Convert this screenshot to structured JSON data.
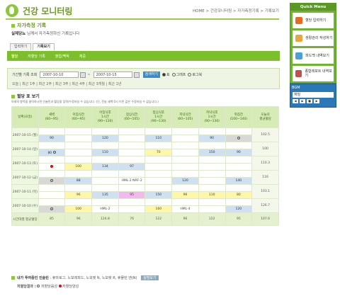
{
  "header": {
    "title": "건강 모니터링",
    "breadcrumb": "HOME > 건강모니터링 > 자가측정기록 > 기록보기"
  },
  "section": {
    "title": "자가측정 기록"
  },
  "greeting": {
    "name": "실제당뇨",
    "text": "님께서 자가측정하신 기록입니다"
  },
  "tabs": [
    {
      "label": "입력하기"
    },
    {
      "label": "기록보기"
    }
  ],
  "subnav": [
    {
      "label": "혈당"
    },
    {
      "label": "자혈당 기록"
    },
    {
      "label": "혈압/맥박"
    },
    {
      "label": "체중"
    }
  ],
  "search": {
    "label": "기간별 기록 조회",
    "start": "2007-10-10",
    "end": "2007-10-15",
    "button": "검색하기",
    "view1": "표",
    "view2": "그래프",
    "view3": "로그북",
    "quick": "오늘 | 최근 1주 | 최근 2주 | 최근 3주 | 최근 4주 | 최근 3개월 | 최근 1년"
  },
  "table_title": "혈당 표 보기",
  "note": "아래의 항목을 클릭하시면 인슐린과 혈당을 입력/수정하실 수 있습니다. (단, 전날 새벽 0시 이전 값은 수정하실 수 없습니다.)",
  "columns": [
    "날짜(요일)",
    "새벽\n(60~95)",
    "아침식전\n(60~95)",
    "아침식후\n1시간\n(90~130)",
    "점심식전\n(60~105)",
    "점심식후\n1시간\n(90~130)",
    "저녁식전\n(60~105)",
    "저녁식후\n1시간\n(90~130)",
    "취침전\n(100~140)",
    "오늘의\n평균혈당"
  ],
  "rows": [
    {
      "date": "2007-10-15 (월)",
      "avg": "102.5",
      "cells": [
        [
          "b",
          "90"
        ],
        [
          "e",
          ""
        ],
        [
          "b",
          "120"
        ],
        [
          "e",
          ""
        ],
        [
          "b",
          "110"
        ],
        [
          "e",
          ""
        ],
        [
          "b",
          "90"
        ],
        [
          "g",
          "o"
        ]
      ]
    },
    {
      "date": "2007-10-14 (일)",
      "avg": "100",
      "cells": [
        [
          "b",
          "80o"
        ],
        [
          "e",
          ""
        ],
        [
          "b",
          "110"
        ],
        [
          "e",
          ""
        ],
        [
          "y",
          "70"
        ],
        [
          "e",
          ""
        ],
        [
          "b",
          "150"
        ],
        [
          "b",
          "90"
        ]
      ]
    },
    {
      "date": "2007-10-13 (토)",
      "avg": "110.3",
      "cells": [
        [
          "r",
          ""
        ],
        [
          "y",
          "100"
        ],
        [
          "b",
          "134"
        ],
        [
          "b",
          "97"
        ],
        [
          "e",
          ""
        ],
        [
          "e",
          ""
        ],
        [
          "e",
          ""
        ],
        [
          "e",
          ""
        ]
      ]
    },
    {
      "date": "2007-10-12 (금)",
      "avg": "116",
      "cells": [
        [
          "g",
          "o"
        ],
        [
          "b",
          "88"
        ],
        [
          "e",
          ""
        ],
        [
          "e",
          "HML-2 NRF-2"
        ],
        [
          "e",
          ""
        ],
        [
          "b",
          "120"
        ],
        [
          "e",
          ""
        ],
        [
          "b",
          "140"
        ]
      ]
    },
    {
      "date": "2007-10-11 (목)",
      "avg": "103.1",
      "cells": [
        [
          "e",
          ""
        ],
        [
          "y",
          "96"
        ],
        [
          "b",
          "135"
        ],
        [
          "p",
          "95"
        ],
        [
          "b",
          "150"
        ],
        [
          "y",
          "96"
        ],
        [
          "y",
          "110"
        ],
        [
          "y",
          "80"
        ]
      ]
    },
    {
      "date": "2007-10-10 (수)",
      "avg": "126.7",
      "cells": [
        [
          "g",
          "o"
        ],
        [
          "y",
          "100"
        ],
        [
          "e",
          "HML-2"
        ],
        [
          "e",
          ""
        ],
        [
          "y",
          "160"
        ],
        [
          "e",
          "HML-4"
        ],
        [
          "e",
          ""
        ],
        [
          "b",
          "120"
        ]
      ]
    }
  ],
  "footer": {
    "label": "시간대별 평균혈당",
    "values": [
      "85",
      "96",
      "124.8",
      "76",
      "122",
      "96",
      "122",
      "95",
      "107.6"
    ]
  },
  "medication": {
    "label": "내가 투여중인 인슐린",
    "value": ": 휴마로그, 노보레피드, 노보렛 N, 노보렛 R, 휴물린 엔(N)",
    "button": "설명보기"
  },
  "legend": {
    "label": "저혈당결과 :",
    "normal": "저혈당음성",
    "low": "저혈당양성"
  },
  "quickmenu": {
    "title": "Quick Menu",
    "items": [
      {
        "label": "혈당 입력하기"
      },
      {
        "label": "생활관리 작성하기"
      },
      {
        "label": "피드백 내역보기"
      },
      {
        "label": "종합레포트 내역보기"
      }
    ]
  },
  "bgm": {
    "title": "BGM",
    "value": "재밀"
  },
  "colors": {
    "accent": "#7bbf2a",
    "title": "#6a9b1d"
  }
}
